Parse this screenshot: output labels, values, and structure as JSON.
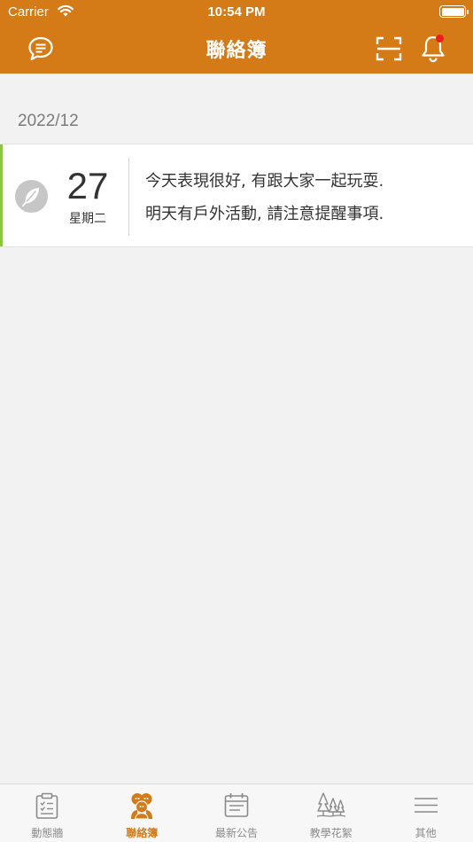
{
  "status_bar": {
    "carrier": "Carrier",
    "time": "10:54 PM"
  },
  "navbar": {
    "title": "聯絡簿"
  },
  "section": {
    "month": "2022/12"
  },
  "entries": [
    {
      "day": "27",
      "weekday": "星期二",
      "lines": [
        "今天表現很好, 有跟大家一起玩耍.",
        "明天有戶外活動, 請注意提醒事項."
      ]
    }
  ],
  "tabs": [
    {
      "label": "動態牆",
      "icon": "clipboard-icon"
    },
    {
      "label": "聯絡簿",
      "icon": "kids-icon"
    },
    {
      "label": "最新公告",
      "icon": "calendar-icon"
    },
    {
      "label": "教學花絮",
      "icon": "trees-icon"
    },
    {
      "label": "其他",
      "icon": "menu-icon"
    }
  ],
  "colors": {
    "accent": "#d47a16",
    "entry_accent": "#8cc63f",
    "notification": "#ee1c1c"
  }
}
